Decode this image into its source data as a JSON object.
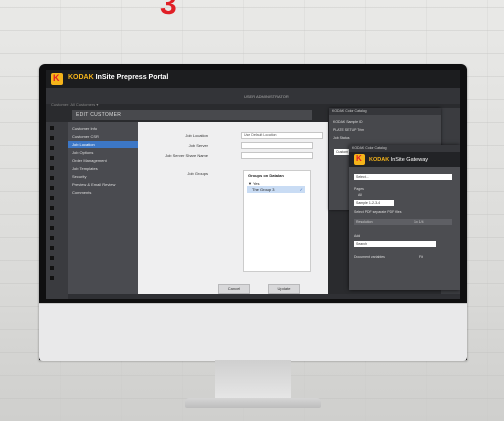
{
  "brand": {
    "kodak": "KODAK",
    "product": "InSite Prepress Portal"
  },
  "header": {
    "user": "USER ADMINISTRATOR"
  },
  "breadcrumb": "Customer: All Customers ▾",
  "page_title": "EDIT CUSTOMER",
  "sidebar": {
    "items": [
      {
        "label": "Customer Info"
      },
      {
        "label": "Customer CSR"
      },
      {
        "label": "Job Location"
      },
      {
        "label": "Job Options"
      },
      {
        "label": "Order Management"
      },
      {
        "label": "Job Templates"
      },
      {
        "label": "Security"
      },
      {
        "label": "Preview & Email Review"
      },
      {
        "label": "Comments"
      }
    ],
    "active_index": 2
  },
  "form": {
    "job_location_label": "Job Location",
    "job_location_value": "Use Default Location",
    "job_server_label": "Job Server",
    "job_server_value": "",
    "job_server_share_label": "Job Server Share Name",
    "job_server_share_value": "",
    "job_groups_label": "Job Groups",
    "groups_header": "Groups on Datalan",
    "groups_yes": "▼ Yes",
    "groups_selected": "The Group 3",
    "cancel": "Cancel",
    "update": "Update"
  },
  "dialog_a": {
    "title": "KODAK Color Catalog",
    "line1": "KODAK Sample ID",
    "line2": "PLATE SETUP Trim",
    "line3": "Job Status",
    "select_value": "Custom EYE"
  },
  "dialog_b": {
    "title": "KODAK Color Catalog",
    "gateway_kodak": "KODAK",
    "gateway_name": "InSite Gateway",
    "select_value": "Select...",
    "pages_label": "Pages",
    "page_opt": "All",
    "sample_value": "Sample 1-2-3-4",
    "checkbox_label": "Select PDF separate PDF files",
    "resolution_label": "Resolution",
    "resolution_value": "1x 1/4",
    "add_label": "Add",
    "add_value": "Search",
    "document_label": "Document variables",
    "document_value": "Fit"
  }
}
